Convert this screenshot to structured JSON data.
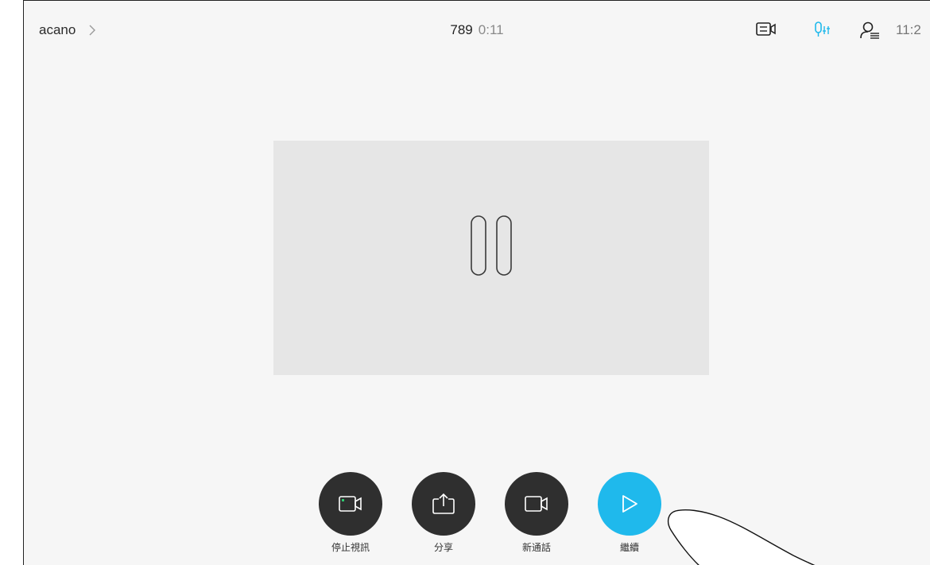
{
  "topbar": {
    "room_name": "acano",
    "call_number": "789",
    "call_duration": "0:11",
    "clock": "11:2",
    "icons": [
      "layout-icon",
      "microphone-settings-icon",
      "participants-icon"
    ]
  },
  "video": {
    "state_icon": "pause-icon"
  },
  "controls": [
    {
      "label": "停止視訊",
      "icon": "camera-active-icon"
    },
    {
      "label": "分享",
      "icon": "share-icon"
    },
    {
      "label": "新通話",
      "icon": "camera-icon"
    },
    {
      "label": "繼續",
      "icon": "play-icon"
    }
  ],
  "colors": {
    "accent": "#1FB9EC",
    "button": "#2F2F2F",
    "background": "#F6F6F6",
    "video_placeholder": "#E6E6E6"
  }
}
